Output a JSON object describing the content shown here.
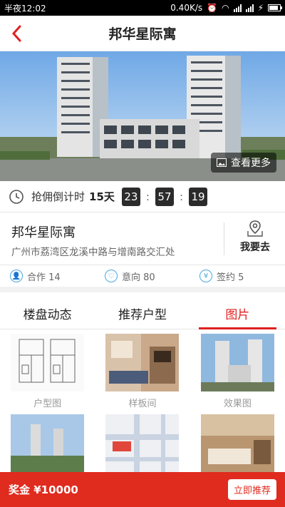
{
  "status_bar": {
    "time": "半夜12:02",
    "network_speed": "0.40K/s"
  },
  "nav": {
    "title": "邦华星际寓"
  },
  "hero": {
    "more_label": "查看更多"
  },
  "countdown": {
    "label": "抢佣倒计时",
    "days": "15天",
    "hours": "23",
    "minutes": "57",
    "seconds": "19",
    "separator": ":"
  },
  "property": {
    "name": "邦华星际寓",
    "address": "广州市荔湾区龙溪中路与增南路交汇处",
    "go_label": "我要去"
  },
  "stats": [
    {
      "label": "合作 14",
      "icon": "user-icon"
    },
    {
      "label": "意向 80",
      "icon": "heart-icon"
    },
    {
      "label": "签约 5",
      "icon": "money-bag-icon"
    }
  ],
  "tabs": [
    {
      "label": "楼盘动态",
      "active": false
    },
    {
      "label": "推荐户型",
      "active": false
    },
    {
      "label": "图片",
      "active": true
    }
  ],
  "gallery": [
    {
      "caption": "户型图"
    },
    {
      "caption": "样板间"
    },
    {
      "caption": "效果图"
    },
    {
      "caption": ""
    },
    {
      "caption": ""
    },
    {
      "caption": ""
    }
  ],
  "bottom": {
    "bonus": "奖金 ¥10000",
    "recommend_label": "立即推荐"
  },
  "colors": {
    "accent": "#e02020",
    "bar": "#e02b1f",
    "stat_icon": "#4aa8e0"
  }
}
